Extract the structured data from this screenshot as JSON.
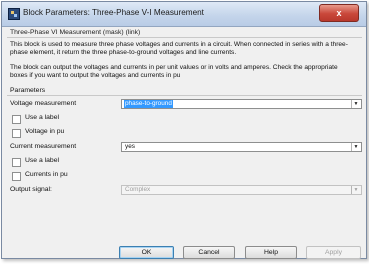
{
  "window": {
    "title": "Block Parameters: Three-Phase V-I Measurement",
    "close_label": "x"
  },
  "block": {
    "header": "Three-Phase VI Measurement (mask) (link)",
    "description_1": "This block is used to measure three phase voltages and currents in a circuit. When connected in series with a three-phase element, it return the three phase-to-ground voltages and line currents.",
    "description_2": "The block can output the voltages and currents in per unit values or in volts and amperes. Check the appropriate boxes if you want to output the voltages and currents in pu"
  },
  "parameters": {
    "header": "Parameters",
    "voltage_measurement_label": "Voltage measurement",
    "voltage_measurement_value": "phase-to-ground",
    "use_label_1": "Use a label",
    "voltage_pu": "Voltage in pu",
    "current_measurement_label": "Current measurement",
    "current_measurement_value": "yes",
    "use_label_2": "Use a label",
    "currents_pu": "Currents in pu",
    "output_signal_label": "Output signal:",
    "output_signal_value": "Complex"
  },
  "buttons": {
    "ok": "OK",
    "cancel": "Cancel",
    "help": "Help",
    "apply": "Apply"
  }
}
